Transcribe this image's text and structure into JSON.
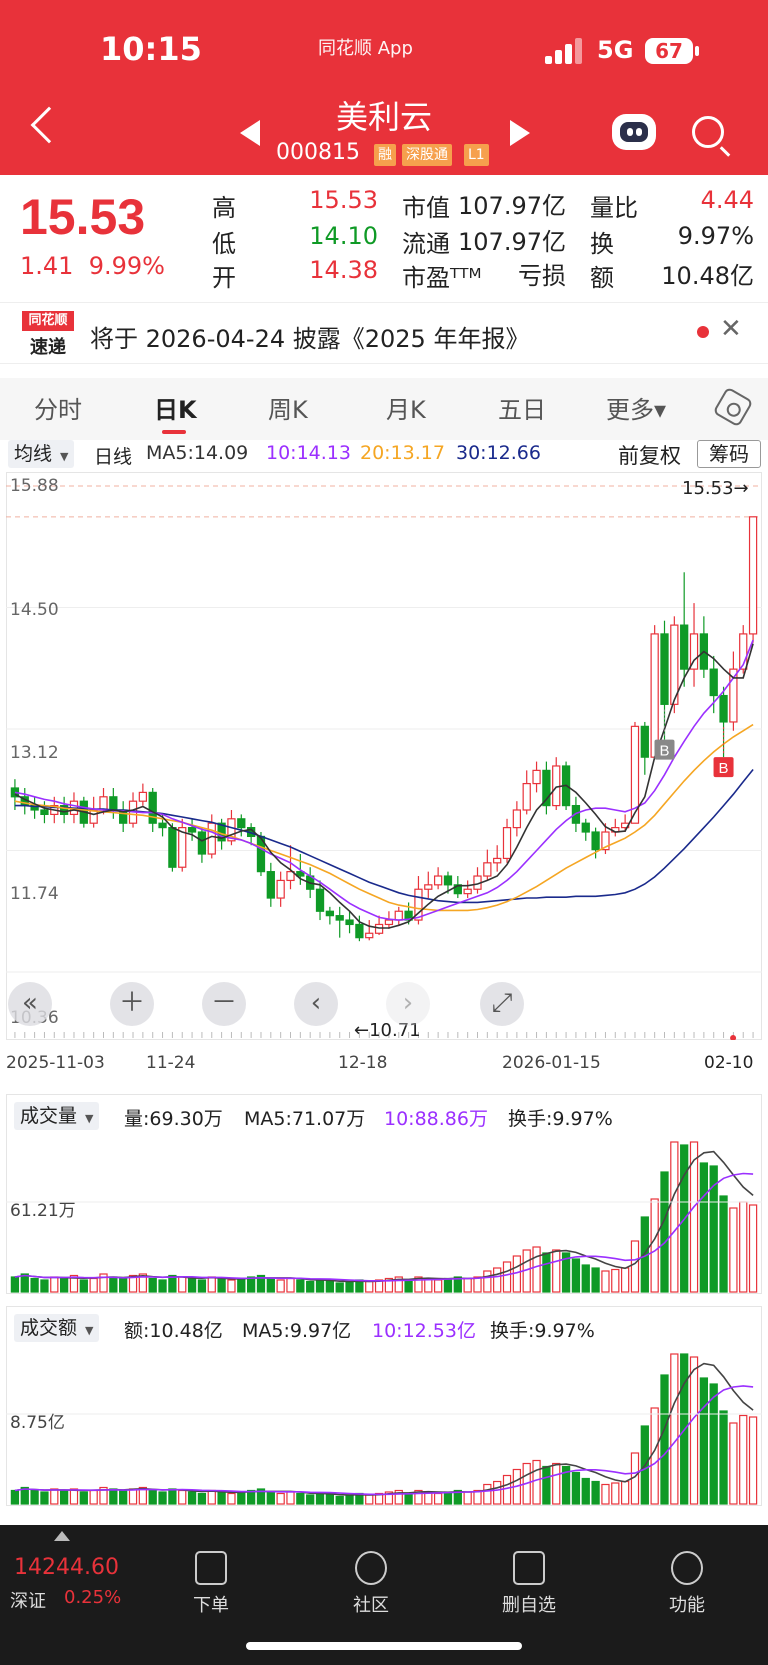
{
  "status_bar": {
    "time": "10:15",
    "app": "同花顺 App",
    "network": "5G",
    "battery": "67"
  },
  "header": {
    "title": "美利云",
    "code": "000815",
    "tags": [
      "融",
      "深股通",
      "L1"
    ]
  },
  "quote": {
    "price": "15.53",
    "change": "1.41",
    "change_pct": "9.99%",
    "high_label": "高",
    "high": "15.53",
    "low_label": "低",
    "low": "14.10",
    "open_label": "开",
    "open": "14.38",
    "mktcap_label": "市值",
    "mktcap": "107.97亿",
    "float_label": "流通",
    "float": "107.97亿",
    "pe_label": "市盈ᵀᵀᴹ",
    "pe": "亏损",
    "vol_ratio_label": "量比",
    "vol_ratio": "4.44",
    "turnover_label": "换",
    "turnover": "9.97%",
    "amount_label": "额",
    "amount": "10.48亿"
  },
  "news": {
    "logo_top": "同花顺",
    "logo_bottom": "速递",
    "text": "将于 2026-04-24 披露《2025 年年报》"
  },
  "tabs": [
    "分时",
    "日K",
    "周K",
    "月K",
    "五日",
    "更多▾"
  ],
  "kline": {
    "ma_selector": "均线",
    "period": "日线",
    "ma5": "MA5:14.09",
    "ma10": "10:14.13",
    "ma20": "20:13.17",
    "ma30": "30:12.66",
    "adjust": "前复权",
    "chips_button": "筹码",
    "y_top": "15.88",
    "y_mid1": "14.50",
    "y_mid2": "13.12",
    "y_mid3": "11.74",
    "y_bottom": "10.36",
    "max_label": "15.53→",
    "min_label": "←10.71",
    "x_labels": [
      "2025-11-03",
      "11-24",
      "12-18",
      "2026-01-15",
      "02-10"
    ],
    "marker_b": "B"
  },
  "volume": {
    "selector": "成交量",
    "vol": "量:69.30万",
    "ma5": "MA5:71.07万",
    "ma10": "10:88.86万",
    "turnover": "换手:9.97%",
    "y_label": "61.21万"
  },
  "amount": {
    "selector": "成交额",
    "amt": "额:10.48亿",
    "ma5": "MA5:9.97亿",
    "ma10": "10:12.53亿",
    "turnover": "换手:9.97%",
    "y_label": "8.75亿"
  },
  "bottom_nav": {
    "index_value": "14244.60",
    "index_name": "深证",
    "index_pct": "0.25%",
    "items": [
      "下单",
      "社区",
      "删自选",
      "功能"
    ]
  },
  "colors": {
    "up": "#E8323A",
    "down": "#0F9A26",
    "ma5": "#333333",
    "ma10": "#9B30FF",
    "ma20": "#F5A623",
    "ma30": "#1A2A8C"
  },
  "chart_data": [
    {
      "type": "candlestick",
      "ylim": [
        10.36,
        15.88
      ],
      "candles": [
        [
          12.45,
          12.35,
          12.55,
          12.2
        ],
        [
          12.35,
          12.25,
          12.45,
          12.15
        ],
        [
          12.25,
          12.2,
          12.35,
          12.1
        ],
        [
          12.2,
          12.15,
          12.3,
          12.05
        ],
        [
          12.15,
          12.25,
          12.35,
          12.05
        ],
        [
          12.25,
          12.15,
          12.35,
          12.05
        ],
        [
          12.15,
          12.3,
          12.4,
          12.05
        ],
        [
          12.3,
          12.05,
          12.35,
          12.0
        ],
        [
          12.05,
          12.2,
          12.35,
          12.0
        ],
        [
          12.2,
          12.35,
          12.45,
          12.15
        ],
        [
          12.35,
          12.2,
          12.45,
          12.1
        ],
        [
          12.2,
          12.05,
          12.3,
          11.95
        ],
        [
          12.05,
          12.3,
          12.4,
          12.0
        ],
        [
          12.3,
          12.4,
          12.5,
          12.25
        ],
        [
          12.4,
          12.05,
          12.45,
          11.95
        ],
        [
          12.05,
          12.0,
          12.15,
          11.9
        ],
        [
          12.0,
          11.55,
          12.05,
          11.5
        ],
        [
          11.55,
          12.0,
          12.1,
          11.5
        ],
        [
          12.0,
          11.95,
          12.1,
          11.85
        ],
        [
          11.95,
          11.7,
          12.0,
          11.6
        ],
        [
          11.7,
          12.05,
          12.15,
          11.65
        ],
        [
          12.05,
          11.85,
          12.1,
          11.75
        ],
        [
          11.85,
          12.1,
          12.2,
          11.8
        ],
        [
          12.1,
          12.0,
          12.15,
          11.9
        ],
        [
          12.0,
          11.9,
          12.05,
          11.8
        ],
        [
          11.9,
          11.5,
          11.95,
          11.45
        ],
        [
          11.5,
          11.2,
          11.6,
          11.1
        ],
        [
          11.2,
          11.4,
          11.5,
          11.1
        ],
        [
          11.4,
          11.5,
          11.8,
          11.3
        ],
        [
          11.5,
          11.45,
          11.7,
          11.35
        ],
        [
          11.45,
          11.3,
          11.55,
          11.2
        ],
        [
          11.3,
          11.05,
          11.4,
          10.95
        ],
        [
          11.05,
          11.0,
          11.1,
          10.9
        ],
        [
          11.0,
          10.95,
          11.1,
          10.75
        ],
        [
          10.95,
          10.9,
          11.05,
          10.8
        ],
        [
          10.9,
          10.75,
          11.0,
          10.71
        ],
        [
          10.75,
          10.8,
          10.95,
          10.72
        ],
        [
          10.8,
          10.9,
          11.0,
          10.78
        ],
        [
          10.9,
          10.95,
          11.05,
          10.85
        ],
        [
          10.95,
          11.05,
          11.1,
          10.9
        ],
        [
          11.05,
          10.95,
          11.15,
          10.9
        ],
        [
          10.95,
          11.3,
          11.45,
          10.9
        ],
        [
          11.3,
          11.35,
          11.5,
          11.2
        ],
        [
          11.35,
          11.45,
          11.55,
          11.3
        ],
        [
          11.45,
          11.35,
          11.5,
          11.25
        ],
        [
          11.35,
          11.25,
          11.45,
          11.2
        ],
        [
          11.25,
          11.3,
          11.4,
          11.2
        ],
        [
          11.3,
          11.45,
          11.55,
          11.25
        ],
        [
          11.45,
          11.6,
          11.75,
          11.4
        ],
        [
          11.6,
          11.65,
          11.8,
          11.5
        ],
        [
          11.65,
          12.0,
          12.1,
          11.6
        ],
        [
          12.0,
          12.2,
          12.3,
          11.9
        ],
        [
          12.2,
          12.5,
          12.65,
          12.15
        ],
        [
          12.5,
          12.65,
          12.75,
          12.4
        ],
        [
          12.65,
          12.25,
          12.75,
          12.15
        ],
        [
          12.25,
          12.7,
          12.8,
          12.2
        ],
        [
          12.7,
          12.25,
          12.75,
          12.2
        ],
        [
          12.25,
          12.05,
          12.35,
          11.95
        ],
        [
          12.05,
          11.95,
          12.1,
          11.85
        ],
        [
          11.95,
          11.75,
          12.0,
          11.65
        ],
        [
          11.75,
          11.95,
          12.05,
          11.7
        ],
        [
          11.95,
          12.0,
          12.1,
          11.9
        ],
        [
          12.0,
          12.05,
          12.15,
          11.95
        ],
        [
          12.05,
          13.15,
          13.2,
          12.05
        ],
        [
          13.15,
          12.8,
          13.2,
          12.6
        ],
        [
          12.8,
          14.2,
          14.3,
          12.8
        ],
        [
          14.2,
          13.4,
          14.35,
          13.0
        ],
        [
          13.4,
          14.3,
          14.4,
          13.3
        ],
        [
          14.3,
          13.8,
          14.9,
          13.6
        ],
        [
          13.8,
          14.2,
          14.55,
          13.6
        ],
        [
          14.2,
          13.8,
          14.4,
          13.7
        ],
        [
          13.8,
          13.5,
          13.95,
          13.3
        ],
        [
          13.5,
          13.2,
          13.6,
          12.8
        ],
        [
          13.2,
          13.8,
          14.0,
          13.1
        ],
        [
          13.8,
          14.2,
          14.3,
          13.75
        ],
        [
          14.2,
          15.53,
          15.53,
          14.1
        ]
      ],
      "ma5": [
        12.38,
        12.32,
        12.27,
        12.22,
        12.2,
        12.18,
        12.2,
        12.18,
        12.15,
        12.18,
        12.2,
        12.18,
        12.2,
        12.24,
        12.18,
        12.12,
        12.0,
        11.95,
        11.92,
        11.85,
        11.9,
        11.88,
        11.92,
        11.96,
        11.98,
        11.88,
        11.72,
        11.6,
        11.52,
        11.42,
        11.37,
        11.35,
        11.26,
        11.15,
        11.05,
        10.93,
        10.88,
        10.86,
        10.86,
        10.89,
        10.93,
        11.03,
        11.13,
        11.22,
        11.28,
        11.34,
        11.34,
        11.36,
        11.4,
        11.45,
        11.58,
        11.78,
        12.0,
        12.2,
        12.32,
        12.46,
        12.48,
        12.4,
        12.28,
        12.15,
        12.01,
        11.95,
        11.96,
        12.17,
        12.35,
        12.8,
        13.12,
        13.45,
        13.7,
        13.9,
        14.0,
        13.92,
        13.8,
        13.7,
        13.7,
        14.09
      ],
      "ma10": [
        12.4,
        12.38,
        12.35,
        12.32,
        12.3,
        12.27,
        12.25,
        12.23,
        12.21,
        12.2,
        12.19,
        12.19,
        12.18,
        12.17,
        12.17,
        12.15,
        12.1,
        12.06,
        12.02,
        11.98,
        11.95,
        11.9,
        11.88,
        11.86,
        11.82,
        11.76,
        11.7,
        11.65,
        11.6,
        11.52,
        11.45,
        11.38,
        11.3,
        11.22,
        11.14,
        11.08,
        11.03,
        10.98,
        10.96,
        10.95,
        10.96,
        10.98,
        11.02,
        11.06,
        11.1,
        11.14,
        11.18,
        11.22,
        11.26,
        11.32,
        11.4,
        11.5,
        11.62,
        11.74,
        11.86,
        11.98,
        12.08,
        12.16,
        12.2,
        12.22,
        12.22,
        12.2,
        12.18,
        12.22,
        12.28,
        12.42,
        12.6,
        12.8,
        12.98,
        13.15,
        13.3,
        13.42,
        13.55,
        13.7,
        13.85,
        14.13
      ],
      "ma20": [
        12.3,
        12.28,
        12.26,
        12.25,
        12.24,
        12.22,
        12.21,
        12.2,
        12.19,
        12.18,
        12.17,
        12.16,
        12.15,
        12.14,
        12.12,
        12.1,
        12.08,
        12.06,
        12.03,
        12.0,
        11.97,
        11.93,
        11.9,
        11.86,
        11.82,
        11.78,
        11.74,
        11.7,
        11.66,
        11.62,
        11.58,
        11.53,
        11.48,
        11.42,
        11.36,
        11.3,
        11.25,
        11.2,
        11.15,
        11.12,
        11.1,
        11.08,
        11.07,
        11.06,
        11.06,
        11.06,
        11.06,
        11.07,
        11.09,
        11.12,
        11.16,
        11.21,
        11.27,
        11.33,
        11.4,
        11.47,
        11.54,
        11.6,
        11.66,
        11.72,
        11.78,
        11.83,
        11.88,
        11.95,
        12.03,
        12.14,
        12.27,
        12.4,
        12.53,
        12.65,
        12.76,
        12.86,
        12.95,
        13.03,
        13.1,
        13.17
      ],
      "ma30": [
        12.25,
        12.25,
        12.24,
        12.24,
        12.23,
        12.23,
        12.22,
        12.22,
        12.21,
        12.21,
        12.2,
        12.2,
        12.19,
        12.18,
        12.17,
        12.16,
        12.14,
        12.12,
        12.1,
        12.08,
        12.06,
        12.03,
        12.0,
        11.97,
        11.94,
        11.9,
        11.86,
        11.82,
        11.78,
        11.73,
        11.68,
        11.63,
        11.58,
        11.53,
        11.48,
        11.43,
        11.38,
        11.34,
        11.3,
        11.26,
        11.23,
        11.21,
        11.19,
        11.17,
        11.16,
        11.15,
        11.15,
        11.15,
        11.16,
        11.17,
        11.18,
        11.19,
        11.2,
        11.2,
        11.21,
        11.21,
        11.21,
        11.22,
        11.22,
        11.22,
        11.23,
        11.24,
        11.26,
        11.3,
        11.36,
        11.44,
        11.54,
        11.65,
        11.76,
        11.88,
        12.0,
        12.12,
        12.25,
        12.38,
        12.52,
        12.66
      ]
    },
    {
      "type": "bar",
      "name": "成交量",
      "ylim": [
        0,
        100
      ],
      "values": [
        10,
        12,
        9,
        8,
        10,
        9,
        11,
        8,
        9,
        12,
        10,
        9,
        11,
        12,
        9,
        8,
        11,
        10,
        9,
        8,
        10,
        9,
        8,
        9,
        10,
        11,
        9,
        8,
        9,
        8,
        7,
        8,
        7,
        6,
        7,
        8,
        7,
        8,
        9,
        10,
        8,
        10,
        9,
        8,
        9,
        10,
        9,
        10,
        14,
        16,
        20,
        24,
        28,
        30,
        26,
        28,
        26,
        22,
        18,
        16,
        14,
        15,
        16,
        34,
        50,
        62,
        80,
        100,
        98,
        100,
        86,
        84,
        64,
        56,
        60,
        58
      ]
    },
    {
      "type": "bar",
      "name": "成交额",
      "ylim": [
        0,
        100
      ],
      "values": [
        9,
        11,
        9,
        8,
        10,
        9,
        10,
        8,
        9,
        11,
        10,
        9,
        10,
        11,
        9,
        8,
        10,
        9,
        8,
        7,
        9,
        8,
        7,
        8,
        9,
        10,
        8,
        7,
        8,
        7,
        6,
        7,
        6,
        5,
        6,
        7,
        6,
        7,
        8,
        9,
        7,
        9,
        8,
        7,
        8,
        9,
        8,
        9,
        13,
        15,
        19,
        23,
        27,
        29,
        25,
        27,
        25,
        21,
        17,
        15,
        13,
        14,
        15,
        34,
        52,
        64,
        86,
        100,
        100,
        98,
        84,
        80,
        62,
        54,
        59,
        58
      ]
    }
  ]
}
